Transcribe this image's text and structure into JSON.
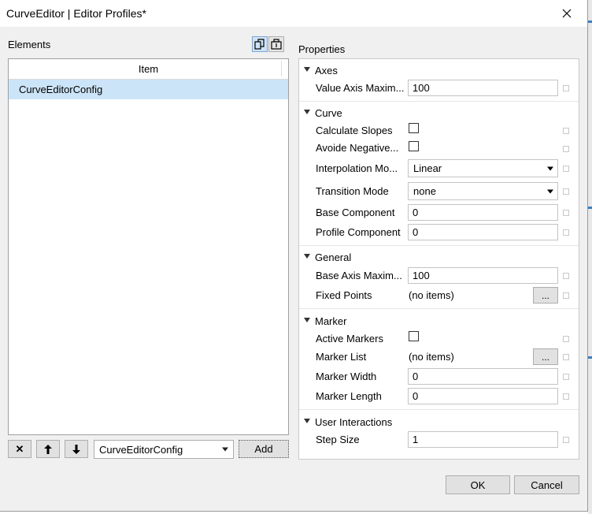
{
  "window": {
    "title": "CurveEditor | Editor Profiles*"
  },
  "elements": {
    "label": "Elements",
    "column_header": "Item",
    "items": [
      "CurveEditorConfig"
    ],
    "type_select": "CurveEditorConfig",
    "add_label": "Add",
    "remove_glyph": "✕",
    "up_glyph": "🡑",
    "down_glyph": "🡓"
  },
  "properties": {
    "label": "Properties",
    "categories": [
      {
        "name": "Axes",
        "props": [
          {
            "name": "Value Axis Maxim...",
            "kind": "text",
            "value": "100"
          }
        ]
      },
      {
        "name": "Curve",
        "props": [
          {
            "name": "Calculate Slopes",
            "kind": "check",
            "value": false
          },
          {
            "name": "Avoide Negative...",
            "kind": "check",
            "value": false
          },
          {
            "name": "Interpolation Mo...",
            "kind": "combo",
            "value": "Linear"
          },
          {
            "name": "Transition Mode",
            "kind": "combo",
            "value": "none"
          },
          {
            "name": "Base Component",
            "kind": "text",
            "value": "0"
          },
          {
            "name": "Profile Component",
            "kind": "text",
            "value": "0"
          }
        ]
      },
      {
        "name": "General",
        "props": [
          {
            "name": "Base Axis Maxim...",
            "kind": "text",
            "value": "100"
          },
          {
            "name": "Fixed Points",
            "kind": "collection",
            "value": "(no items)"
          }
        ]
      },
      {
        "name": "Marker",
        "props": [
          {
            "name": "Active Markers",
            "kind": "check",
            "value": false
          },
          {
            "name": "Marker List",
            "kind": "collection",
            "value": "(no items)"
          },
          {
            "name": "Marker Width",
            "kind": "text",
            "value": "0"
          },
          {
            "name": "Marker Length",
            "kind": "text",
            "value": "0"
          }
        ]
      },
      {
        "name": "User Interactions",
        "props": [
          {
            "name": "Step Size",
            "kind": "text",
            "value": "1"
          }
        ]
      }
    ]
  },
  "ellipsis_label": "...",
  "footer": {
    "ok_label": "OK",
    "cancel_label": "Cancel"
  },
  "colors": {
    "selection": "#cce4f7",
    "accent": "#3c7fc4"
  }
}
